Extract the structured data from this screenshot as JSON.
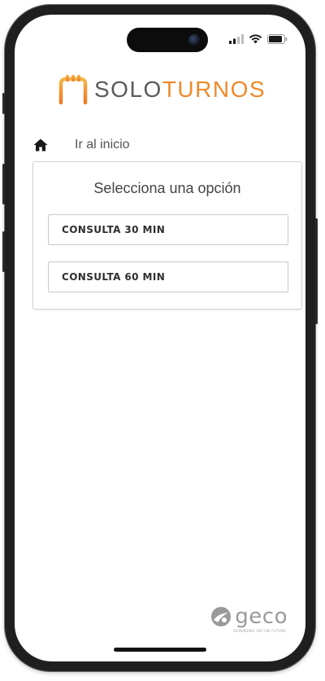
{
  "status_bar": {
    "icons": [
      "signal-icon",
      "wifi-icon",
      "battery-icon"
    ]
  },
  "brand": {
    "logo_part1": "SOLO",
    "logo_part2": "TURNOS",
    "accent_color": "#ee8a2a",
    "text_color": "#5a5a5a"
  },
  "breadcrumb": {
    "icon": "home-icon",
    "label": "Ir al inicio"
  },
  "options_card": {
    "title": "Selecciona una opción",
    "options": [
      {
        "label": "CONSULTA 30 MIN"
      },
      {
        "label": "CONSULTA 60 MIN"
      }
    ]
  },
  "footer": {
    "brand": "geco",
    "tagline": "DEPENDING ON THE FUTURE"
  }
}
